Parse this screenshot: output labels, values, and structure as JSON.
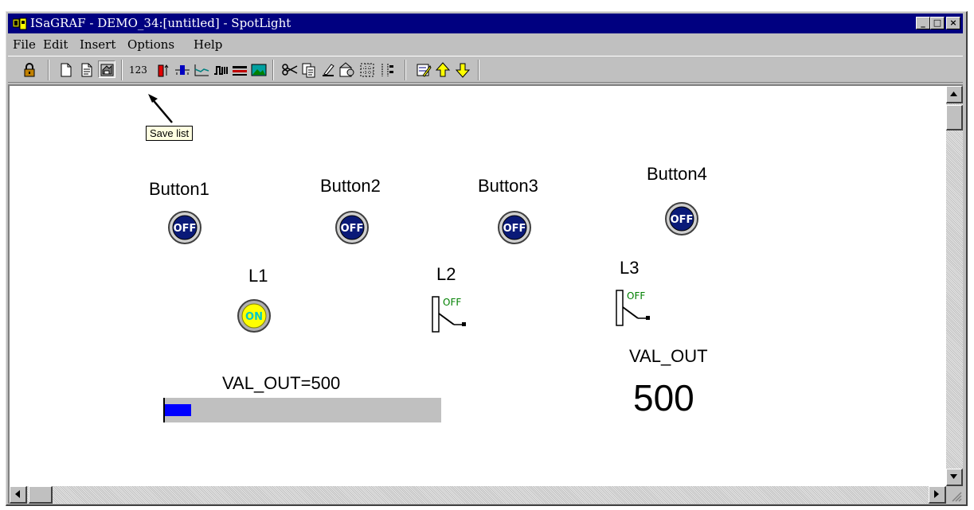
{
  "window": {
    "title": "ISaGRAF - DEMO_34:[untitled] - SpotLight",
    "minimize_glyph": "_",
    "maximize_glyph": "□",
    "close_glyph": "×"
  },
  "menu": {
    "items": [
      {
        "label": "File"
      },
      {
        "label": "Edit"
      },
      {
        "label": "Insert"
      },
      {
        "label": "Options"
      },
      {
        "label": "Help"
      }
    ]
  },
  "toolbar": {
    "icons": [
      "lock-icon",
      "new-list-icon",
      "open-list-icon",
      "save-list-icon",
      "numeric-display-icon",
      "bar-graph-icon",
      "slider-icon",
      "trend-icon",
      "digital-icon",
      "switch-icon",
      "bitmap-icon",
      "cut-icon",
      "copy-icon",
      "paint-icon",
      "properties-icon",
      "grid-icon",
      "align-icon",
      "edit-variables-icon",
      "move-up-icon",
      "move-down-icon"
    ],
    "numeric_label": "123",
    "tooltip": "Save list"
  },
  "canvas": {
    "buttons": [
      {
        "label": "Button1",
        "state": "OFF"
      },
      {
        "label": "Button2",
        "state": "OFF"
      },
      {
        "label": "Button3",
        "state": "OFF"
      },
      {
        "label": "Button4",
        "state": "OFF"
      }
    ],
    "lamp": {
      "label": "L1",
      "state": "ON"
    },
    "switches": [
      {
        "label": "L2",
        "state": "OFF"
      },
      {
        "label": "L3",
        "state": "OFF"
      }
    ],
    "bar": {
      "label": "VAL_OUT=500",
      "fill_fraction": 0.095
    },
    "numeric": {
      "label": "VAL_OUT",
      "value": "500"
    }
  },
  "colors": {
    "title_bar": "#000080",
    "button_face": "#0a1a78",
    "lamp_on": "#ffff00",
    "lamp_text": "#00c8c8",
    "switch_text": "#008000",
    "bar_fill": "#0000ff",
    "bar_track": "#c0c0c0",
    "annotation_arrow": "#000000"
  }
}
